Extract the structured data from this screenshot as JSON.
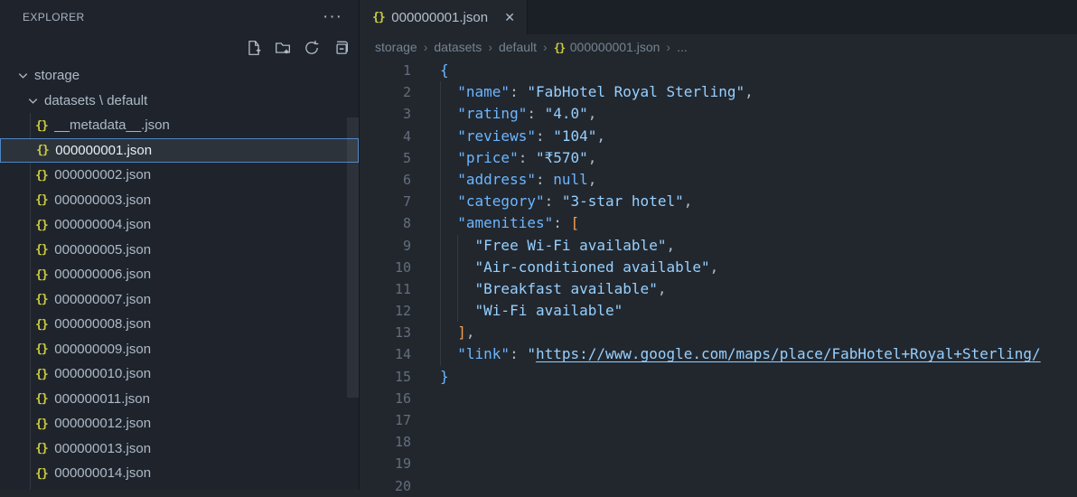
{
  "colors": {
    "editor_bg": "#22272e",
    "sidebar_bg": "#1f242c",
    "tabstrip_bg": "#1b2027",
    "key_blue": "#6cb6ff",
    "string_blue": "#96d0ff",
    "bracket_orange": "#f69d50",
    "json_icon_yellow": "#cbcb41",
    "selection_border": "#4c86c6",
    "selection_bg": "#2d333b"
  },
  "sidebar": {
    "title": "EXPLORER",
    "actions": [
      "new-file",
      "new-folder",
      "refresh-explorer",
      "collapse-folders"
    ],
    "tree": [
      {
        "label": "storage",
        "type": "folder",
        "level": 0
      },
      {
        "label": "datasets \\ default",
        "type": "folder",
        "level": 1
      },
      {
        "label": "__metadata__.json",
        "type": "file",
        "level": 2
      },
      {
        "label": "000000001.json",
        "type": "file",
        "level": 2,
        "selected": true
      },
      {
        "label": "000000002.json",
        "type": "file",
        "level": 2
      },
      {
        "label": "000000003.json",
        "type": "file",
        "level": 2
      },
      {
        "label": "000000004.json",
        "type": "file",
        "level": 2
      },
      {
        "label": "000000005.json",
        "type": "file",
        "level": 2
      },
      {
        "label": "000000006.json",
        "type": "file",
        "level": 2
      },
      {
        "label": "000000007.json",
        "type": "file",
        "level": 2
      },
      {
        "label": "000000008.json",
        "type": "file",
        "level": 2
      },
      {
        "label": "000000009.json",
        "type": "file",
        "level": 2
      },
      {
        "label": "000000010.json",
        "type": "file",
        "level": 2
      },
      {
        "label": "000000011.json",
        "type": "file",
        "level": 2
      },
      {
        "label": "000000012.json",
        "type": "file",
        "level": 2
      },
      {
        "label": "000000013.json",
        "type": "file",
        "level": 2
      },
      {
        "label": "000000014.json",
        "type": "file",
        "level": 2
      }
    ]
  },
  "editor": {
    "tab": {
      "label": "000000001.json",
      "close_glyph": "✕"
    },
    "breadcrumbs": [
      {
        "label": "storage"
      },
      {
        "label": "datasets"
      },
      {
        "label": "default"
      },
      {
        "label": "000000001.json",
        "icon": "json"
      },
      {
        "label": "..."
      }
    ],
    "code": {
      "lines": [
        {
          "n": 1,
          "tokens": [
            [
              "b1",
              "{"
            ]
          ]
        },
        {
          "n": 2,
          "tokens": [
            [
              "ws",
              "  "
            ],
            [
              "key",
              "\"name\""
            ],
            [
              "pu",
              ": "
            ],
            [
              "str",
              "\"FabHotel Royal Sterling\""
            ],
            [
              "pu",
              ","
            ]
          ]
        },
        {
          "n": 3,
          "tokens": [
            [
              "ws",
              "  "
            ],
            [
              "key",
              "\"rating\""
            ],
            [
              "pu",
              ": "
            ],
            [
              "str",
              "\"4.0\""
            ],
            [
              "pu",
              ","
            ]
          ]
        },
        {
          "n": 4,
          "tokens": [
            [
              "ws",
              "  "
            ],
            [
              "key",
              "\"reviews\""
            ],
            [
              "pu",
              ": "
            ],
            [
              "str",
              "\"104\""
            ],
            [
              "pu",
              ","
            ]
          ]
        },
        {
          "n": 5,
          "tokens": [
            [
              "ws",
              "  "
            ],
            [
              "key",
              "\"price\""
            ],
            [
              "pu",
              ": "
            ],
            [
              "str",
              "\"₹570\""
            ],
            [
              "pu",
              ","
            ]
          ]
        },
        {
          "n": 6,
          "tokens": [
            [
              "ws",
              "  "
            ],
            [
              "key",
              "\"address\""
            ],
            [
              "pu",
              ": "
            ],
            [
              "kw",
              "null"
            ],
            [
              "pu",
              ","
            ]
          ]
        },
        {
          "n": 7,
          "tokens": [
            [
              "ws",
              "  "
            ],
            [
              "key",
              "\"category\""
            ],
            [
              "pu",
              ": "
            ],
            [
              "str",
              "\"3-star hotel\""
            ],
            [
              "pu",
              ","
            ]
          ]
        },
        {
          "n": 8,
          "tokens": [
            [
              "ws",
              "  "
            ],
            [
              "key",
              "\"amenities\""
            ],
            [
              "pu",
              ": "
            ],
            [
              "b2",
              "["
            ]
          ]
        },
        {
          "n": 9,
          "tokens": [
            [
              "ws",
              "    "
            ],
            [
              "str",
              "\"Free Wi-Fi available\""
            ],
            [
              "pu",
              ","
            ]
          ]
        },
        {
          "n": 10,
          "tokens": [
            [
              "ws",
              "    "
            ],
            [
              "str",
              "\"Air-conditioned available\""
            ],
            [
              "pu",
              ","
            ]
          ]
        },
        {
          "n": 11,
          "tokens": [
            [
              "ws",
              "    "
            ],
            [
              "str",
              "\"Breakfast available\""
            ],
            [
              "pu",
              ","
            ]
          ]
        },
        {
          "n": 12,
          "tokens": [
            [
              "ws",
              "    "
            ],
            [
              "str",
              "\"Wi-Fi available\""
            ]
          ]
        },
        {
          "n": 13,
          "tokens": [
            [
              "ws",
              "  "
            ],
            [
              "b2",
              "]"
            ],
            [
              "pu",
              ","
            ]
          ]
        },
        {
          "n": 14,
          "tokens": [
            [
              "ws",
              "  "
            ],
            [
              "key",
              "\"link\""
            ],
            [
              "pu",
              ": "
            ],
            [
              "str",
              "\""
            ],
            [
              "link",
              "https://www.google.com/maps/place/FabHotel+Royal+Sterling/"
            ]
          ]
        },
        {
          "n": 15,
          "tokens": [
            [
              "b1",
              "}"
            ]
          ]
        },
        {
          "n": 16,
          "tokens": []
        },
        {
          "n": 17,
          "tokens": []
        },
        {
          "n": 18,
          "tokens": []
        },
        {
          "n": 19,
          "tokens": []
        },
        {
          "n": 20,
          "tokens": []
        }
      ]
    }
  }
}
